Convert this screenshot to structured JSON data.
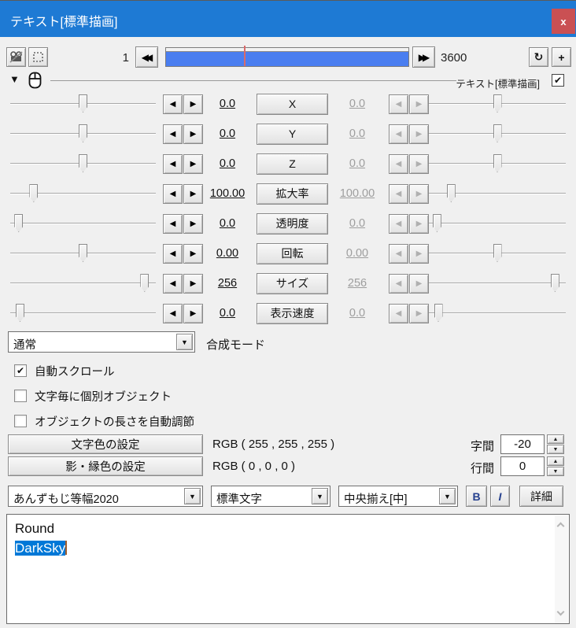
{
  "window": {
    "title": "テキスト[標準描画]"
  },
  "colors": {
    "titlebar": "#1e7ad4",
    "close": "#ca5053",
    "timeline_fill": "#4a7ef0",
    "selection": "#0078d7",
    "accent_text": "#25408f",
    "marker": "#d96a6a",
    "caret": "#a35f2e"
  },
  "icons": {
    "close": "x",
    "arrow_left": "◀",
    "arrow_right": "▶",
    "refresh": "↻",
    "add": "+",
    "dropdown": "▼",
    "expand": "▼",
    "check": "✔",
    "spin_up": "▲",
    "spin_down": "▼"
  },
  "timeline": {
    "current_frame": "1",
    "total_frames": "3600",
    "marker_fraction": 0.32
  },
  "object_header": {
    "label": "テキスト[標準描画]",
    "enabled": true
  },
  "params": {
    "rows": [
      {
        "label": "X",
        "left_value": "0.0",
        "right_value": "0.0",
        "left_fraction": 0.5,
        "right_fraction": 0.5
      },
      {
        "label": "Y",
        "left_value": "0.0",
        "right_value": "0.0",
        "left_fraction": 0.5,
        "right_fraction": 0.5
      },
      {
        "label": "Z",
        "left_value": "0.0",
        "right_value": "0.0",
        "left_fraction": 0.5,
        "right_fraction": 0.5
      },
      {
        "label": "拡大率",
        "left_value": "100.00",
        "right_value": "100.00",
        "left_fraction": 0.14,
        "right_fraction": 0.14
      },
      {
        "label": "透明度",
        "left_value": "0.0",
        "right_value": "0.0",
        "left_fraction": 0.03,
        "right_fraction": 0.03
      },
      {
        "label": "回転",
        "left_value": "0.00",
        "right_value": "0.00",
        "left_fraction": 0.5,
        "right_fraction": 0.5
      },
      {
        "label": "サイズ",
        "left_value": "256",
        "right_value": "256",
        "left_fraction": 0.95,
        "right_fraction": 0.95
      },
      {
        "label": "表示速度",
        "left_value": "0.0",
        "right_value": "0.0",
        "left_fraction": 0.04,
        "right_fraction": 0.04
      }
    ]
  },
  "blend": {
    "selected": "通常",
    "label": "合成モード"
  },
  "options": [
    {
      "label": "自動スクロール",
      "checked": true
    },
    {
      "label": "文字毎に個別オブジェクト",
      "checked": false
    },
    {
      "label": "オブジェクトの長さを自動調節",
      "checked": false
    }
  ],
  "color_settings": [
    {
      "button": "文字色の設定",
      "value": "RGB ( 255 , 255 , 255 )"
    },
    {
      "button": "影・縁色の設定",
      "value": "RGB ( 0 , 0 , 0 )"
    }
  ],
  "spacing": [
    {
      "label": "字間",
      "value": "-20"
    },
    {
      "label": "行間",
      "value": "0"
    }
  ],
  "font_bar": {
    "font": "あんずもじ等幅2020",
    "style": "標準文字",
    "align": "中央揃え[中]",
    "bold": "B",
    "italic": "I",
    "detail": "詳細"
  },
  "text": {
    "lines": [
      "Round",
      "DarkSky"
    ],
    "selected_line": 1
  }
}
